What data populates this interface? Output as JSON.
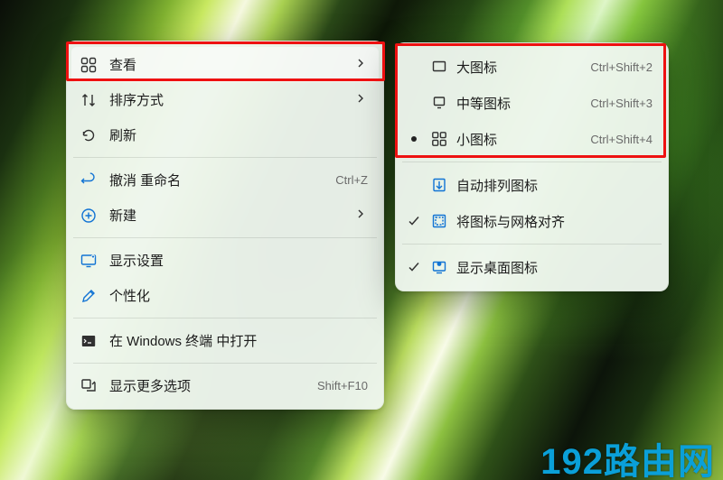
{
  "main_menu": {
    "view": {
      "label": "查看"
    },
    "sort": {
      "label": "排序方式"
    },
    "refresh": {
      "label": "刷新"
    },
    "undo": {
      "label": "撤消 重命名",
      "accel": "Ctrl+Z"
    },
    "new": {
      "label": "新建"
    },
    "display": {
      "label": "显示设置"
    },
    "personalize": {
      "label": "个性化"
    },
    "terminal": {
      "label": "在 Windows 终端 中打开"
    },
    "more": {
      "label": "显示更多选项",
      "accel": "Shift+F10"
    }
  },
  "sub_menu": {
    "large": {
      "label": "大图标",
      "accel": "Ctrl+Shift+2"
    },
    "medium": {
      "label": "中等图标",
      "accel": "Ctrl+Shift+3"
    },
    "small": {
      "label": "小图标",
      "accel": "Ctrl+Shift+4"
    },
    "auto": {
      "label": "自动排列图标"
    },
    "align": {
      "label": "将图标与网格对齐"
    },
    "show": {
      "label": "显示桌面图标"
    }
  },
  "watermark": "192路由网"
}
